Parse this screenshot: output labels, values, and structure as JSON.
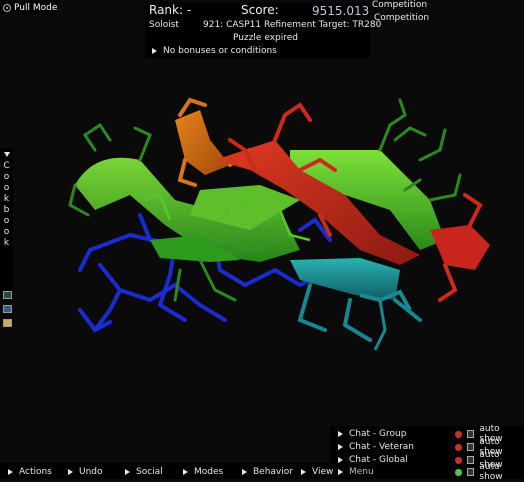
{
  "mode": {
    "label": "Pull Mode"
  },
  "score_panel": {
    "rank_label": "Rank: -",
    "score_label": "Score:",
    "score_value": "9515.013",
    "player_mode": "Soloist",
    "puzzle_title": "921: CASP11 Refinement Target: TR280",
    "status": "Puzzle expired",
    "bonuses": "No bonuses or conditions"
  },
  "competition": {
    "line1": "Competition",
    "line2": "Competition"
  },
  "cookbook": {
    "label": "Cookbook",
    "letters": [
      "C",
      "o",
      "o",
      "k",
      "b",
      "o",
      "o",
      "k"
    ]
  },
  "chat": [
    {
      "label": "Chat - Group",
      "auto": "auto show",
      "status": "off"
    },
    {
      "label": "Chat - Veteran",
      "auto": "auto show",
      "status": "off"
    },
    {
      "label": "Chat - Global",
      "auto": "auto show",
      "status": "off"
    },
    {
      "label": "Menu",
      "auto": "auto show",
      "status": "on"
    }
  ],
  "menu": {
    "actions": "Actions",
    "undo": "Undo",
    "social": "Social",
    "modes": "Modes",
    "behavior": "Behavior",
    "view": "View"
  },
  "colors": {
    "background": "#0a0a0a",
    "score_value": "#bbccdd",
    "dot_off": "#c93030",
    "dot_on": "#44d044"
  }
}
